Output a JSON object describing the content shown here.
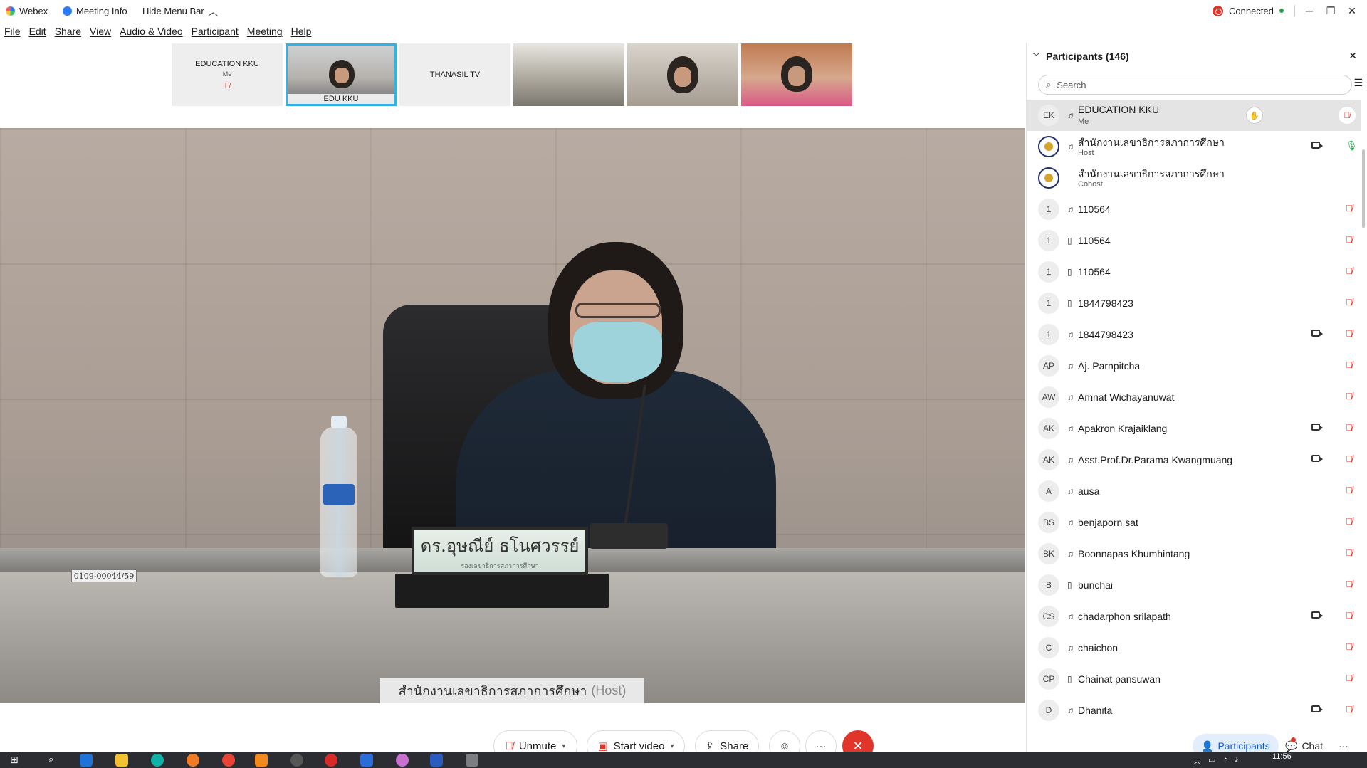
{
  "titlebar": {
    "app_name": "Webex",
    "meeting_info": "Meeting Info",
    "hide_menu_bar": "Hide Menu Bar",
    "connection_status": "Connected"
  },
  "menu": [
    "File",
    "Edit",
    "Share",
    "View",
    "Audio & Video",
    "Participant",
    "Meeting",
    "Help"
  ],
  "thumbnails": [
    {
      "label": "EDUCATION KKU",
      "sub": "Me",
      "type": "tile",
      "muted": true
    },
    {
      "label": "EDU KKU",
      "type": "video",
      "active": true
    },
    {
      "label": "THANASIL TV",
      "type": "tile"
    },
    {
      "label": "",
      "type": "video"
    },
    {
      "label": "",
      "type": "video"
    },
    {
      "label": "",
      "type": "video"
    }
  ],
  "stage": {
    "speaker_name": "สำนักงานเลขาธิการสภาการศึกษา",
    "speaker_role": "(Host)",
    "nameplate_main": "ดร.อุษณีย์ ธโนศวรรย์",
    "nameplate_sub": "รองเลขาธิการสภาการศึกษา",
    "desk_label": "0109-00044/59"
  },
  "controls": {
    "unmute": "Unmute",
    "start_video": "Start video",
    "share": "Share",
    "more": "···"
  },
  "panel": {
    "title": "Participants (146)",
    "search_placeholder": "Search",
    "participants": [
      {
        "avatar": "EK",
        "name": "EDUCATION KKU",
        "role": "Me",
        "device": "headset",
        "camera": false,
        "mic": "muted-circle",
        "hand": true
      },
      {
        "avatar": "",
        "seal": true,
        "name": "สำนักงานเลขาธิการสภาการศึกษา",
        "role": "Host",
        "device": "headset",
        "camera": true,
        "mic": "live"
      },
      {
        "avatar": "",
        "seal": true,
        "name": "สำนักงานเลขาธิการสภาการศึกษา",
        "role": "Cohost",
        "device": "",
        "camera": false,
        "mic": ""
      },
      {
        "avatar": "1",
        "name": "110564",
        "device": "headset",
        "camera": false,
        "mic": "muted"
      },
      {
        "avatar": "1",
        "name": "110564",
        "device": "phone",
        "camera": false,
        "mic": "muted"
      },
      {
        "avatar": "1",
        "name": "110564",
        "device": "phone",
        "camera": false,
        "mic": "muted"
      },
      {
        "avatar": "1",
        "name": "1844798423",
        "device": "phone",
        "camera": false,
        "mic": "muted"
      },
      {
        "avatar": "1",
        "name": "1844798423",
        "device": "headset",
        "camera": true,
        "mic": "muted"
      },
      {
        "avatar": "AP",
        "name": "Aj. Parnpitcha",
        "device": "headset",
        "camera": false,
        "mic": "muted"
      },
      {
        "avatar": "AW",
        "name": "Amnat Wichayanuwat",
        "device": "headset",
        "camera": false,
        "mic": "muted"
      },
      {
        "avatar": "AK",
        "name": "Apakron Krajaiklang",
        "device": "headset",
        "camera": true,
        "mic": "muted"
      },
      {
        "avatar": "AK",
        "name": "Asst.Prof.Dr.Parama Kwangmuang",
        "device": "headset",
        "camera": true,
        "mic": "muted"
      },
      {
        "avatar": "A",
        "name": "ausa",
        "device": "headset",
        "camera": false,
        "mic": "muted"
      },
      {
        "avatar": "BS",
        "name": "benjaporn sat",
        "device": "headset",
        "camera": false,
        "mic": "muted"
      },
      {
        "avatar": "BK",
        "name": "Boonnapas Khumhintang",
        "device": "headset",
        "camera": false,
        "mic": "muted"
      },
      {
        "avatar": "B",
        "name": "bunchai",
        "device": "phone",
        "camera": false,
        "mic": "muted"
      },
      {
        "avatar": "CS",
        "name": "chadarphon srilapath",
        "device": "headset",
        "camera": true,
        "mic": "muted"
      },
      {
        "avatar": "C",
        "name": "chaichon",
        "device": "headset",
        "camera": false,
        "mic": "muted"
      },
      {
        "avatar": "CP",
        "name": "Chainat pansuwan",
        "device": "phone",
        "camera": false,
        "mic": "muted"
      },
      {
        "avatar": "D",
        "name": "Dhanita",
        "device": "headset",
        "camera": true,
        "mic": "muted"
      }
    ],
    "footer": {
      "participants_tab": "Participants",
      "chat_tab": "Chat",
      "more": "···"
    }
  },
  "taskbar": {
    "clock": "11:56"
  },
  "colors": {
    "accent": "#2fb4e8",
    "danger": "#e0352b",
    "online": "#22a34a",
    "active_tab": "#1a5ec9"
  }
}
